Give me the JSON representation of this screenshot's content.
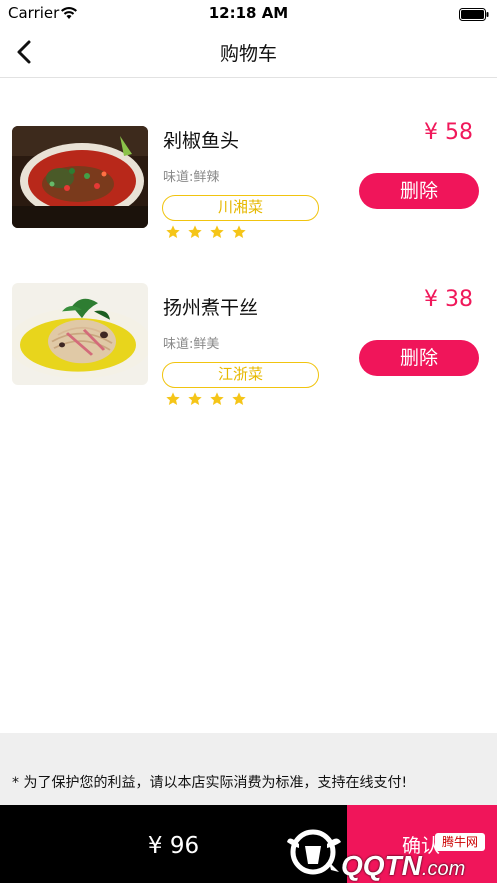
{
  "status_bar": {
    "carrier": "Carrier",
    "time": "12:18 AM"
  },
  "nav": {
    "title": "购物车"
  },
  "cart_items": [
    {
      "name": "剁椒鱼头",
      "taste": "味道:鲜辣",
      "cuisine": "川湘菜",
      "price": "¥ 58",
      "rating": 4,
      "delete_label": "删除"
    },
    {
      "name": "扬州煮干丝",
      "taste": "味道:鲜美",
      "cuisine": "江浙菜",
      "price": "¥ 38",
      "rating": 4,
      "delete_label": "删除"
    }
  ],
  "notice": "* 为了保护您的利益，请以本店实际消费为标准，支持在线支付!",
  "footer": {
    "total": "¥ 96",
    "confirm_label": "确认"
  },
  "watermark": {
    "text": "QQTN",
    "suffix": ".com",
    "badge": "腾牛网"
  },
  "colors": {
    "accent": "#f0155a",
    "tag_yellow": "#f1c40f",
    "star": "#f5c518"
  }
}
